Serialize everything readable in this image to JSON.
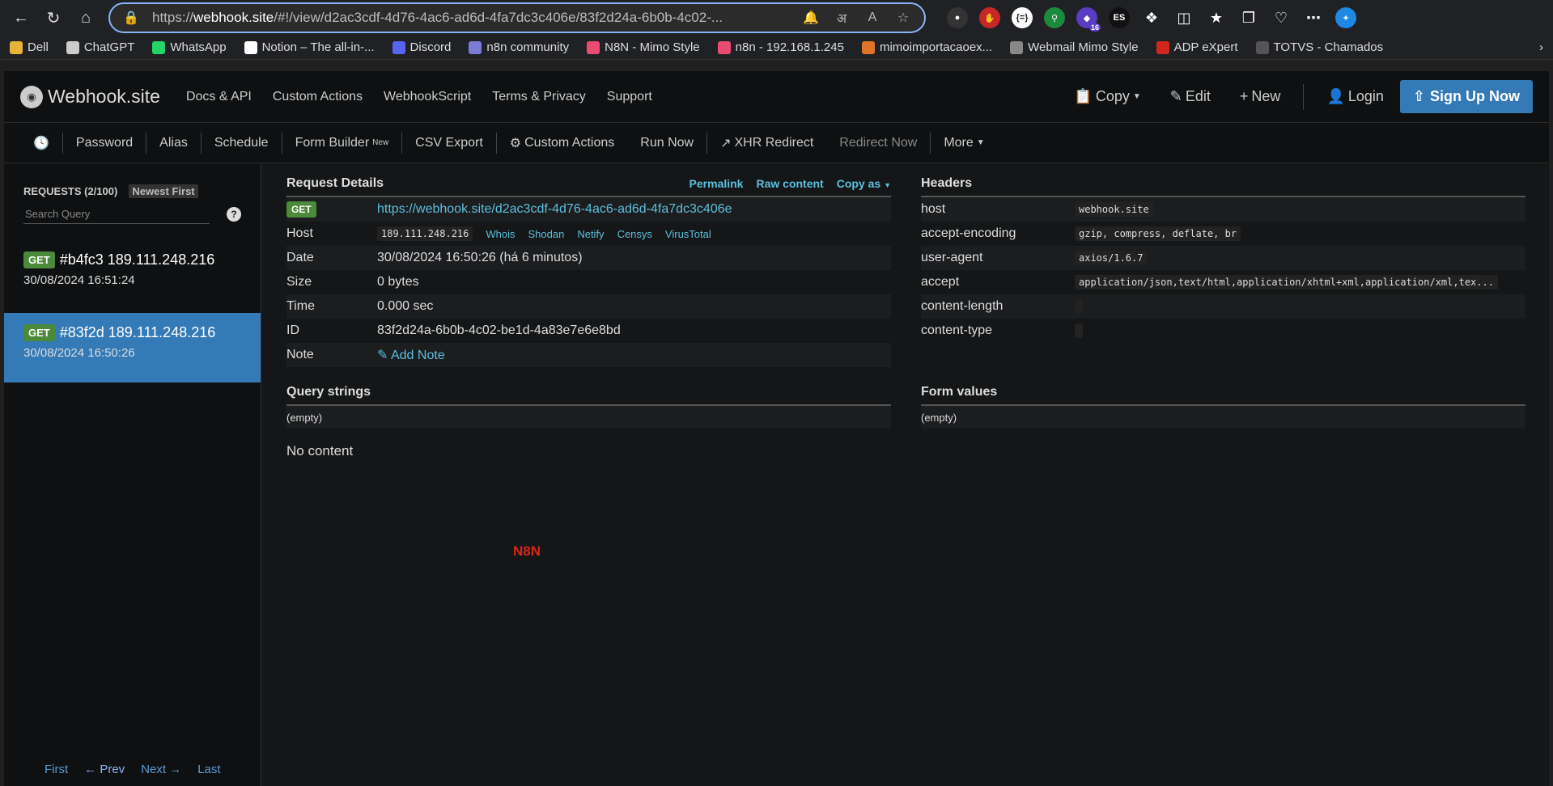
{
  "browser": {
    "url_prefix": "https://",
    "url_host": "webhook.site",
    "url_rest": "/#!/view/d2ac3cdf-4d76-4ac6-ad6d-4fa7dc3c406e/83f2d24a-6b0b-4c02-...",
    "ext_badge": "16"
  },
  "bookmarks": [
    {
      "label": "Dell",
      "color": "#e8b339"
    },
    {
      "label": "ChatGPT",
      "color": "#cccccc"
    },
    {
      "label": "WhatsApp",
      "color": "#25d366"
    },
    {
      "label": "Notion – The all-in-...",
      "color": "#ffffff"
    },
    {
      "label": "Discord",
      "color": "#5865f2"
    },
    {
      "label": "n8n community",
      "color": "#7b7bd8"
    },
    {
      "label": "N8N - Mimo Style",
      "color": "#ea4b71"
    },
    {
      "label": "n8n - 192.168.1.245",
      "color": "#ea4b71"
    },
    {
      "label": "mimoimportacaoex...",
      "color": "#e0742a"
    },
    {
      "label": "Webmail Mimo Style",
      "color": "#888888"
    },
    {
      "label": "ADP eXpert",
      "color": "#d0271d"
    },
    {
      "label": "TOTVS - Chamados",
      "color": "#555555"
    }
  ],
  "nav": {
    "brand": "Webhook.site",
    "links": [
      "Docs & API",
      "Custom Actions",
      "WebhookScript",
      "Terms & Privacy",
      "Support"
    ],
    "copy": "Copy",
    "edit": "Edit",
    "new": "New",
    "login": "Login",
    "signup": "Sign Up Now"
  },
  "toolbar": {
    "password": "Password",
    "alias": "Alias",
    "schedule": "Schedule",
    "form_builder": "Form Builder",
    "form_builder_sup": "New",
    "csv_export": "CSV Export",
    "custom_actions": "Custom Actions",
    "run_now": "Run Now",
    "xhr_redirect": "XHR Redirect",
    "redirect_now": "Redirect Now",
    "more": "More"
  },
  "sidebar": {
    "requests_label": "REQUESTS (2/100)",
    "sort": "Newest First",
    "search_placeholder": "Search Query",
    "requests": [
      {
        "method": "GET",
        "title": "#b4fc3 189.111.248.216",
        "date": "30/08/2024 16:51:24"
      },
      {
        "method": "GET",
        "title": "#83f2d 189.111.248.216",
        "date": "30/08/2024 16:50:26"
      }
    ],
    "pager": {
      "first": "First",
      "prev": "← Prev",
      "next": "Next →",
      "last": "Last"
    }
  },
  "details": {
    "title": "Request Details",
    "permalink": "Permalink",
    "raw": "Raw content",
    "copy_as": "Copy as",
    "method": "GET",
    "url": "https://webhook.site/d2ac3cdf-4d76-4ac6-ad6d-4fa7dc3c406e",
    "host_label": "Host",
    "host": "189.111.248.216",
    "host_links": [
      "Whois",
      "Shodan",
      "Netify",
      "Censys",
      "VirusTotal"
    ],
    "date_label": "Date",
    "date": "30/08/2024 16:50:26 (há 6 minutos)",
    "size_label": "Size",
    "size": "0 bytes",
    "time_label": "Time",
    "time": "0.000 sec",
    "id_label": "ID",
    "id": "83f2d24a-6b0b-4c02-be1d-4a83e7e6e8bd",
    "note_label": "Note",
    "add_note": "Add Note"
  },
  "headers": {
    "title": "Headers",
    "rows": [
      {
        "k": "host",
        "v": "webhook.site"
      },
      {
        "k": "accept-encoding",
        "v": "gzip, compress, deflate, br"
      },
      {
        "k": "user-agent",
        "v": "axios/1.6.7"
      },
      {
        "k": "accept",
        "v": "application/json,text/html,application/xhtml+xml,application/xml,tex..."
      },
      {
        "k": "content-length",
        "v": ""
      },
      {
        "k": "content-type",
        "v": ""
      }
    ]
  },
  "query": {
    "title": "Query strings",
    "empty": "(empty)"
  },
  "form": {
    "title": "Form values",
    "empty": "(empty)"
  },
  "content": {
    "no_content": "No content",
    "body_text": "N8N"
  }
}
